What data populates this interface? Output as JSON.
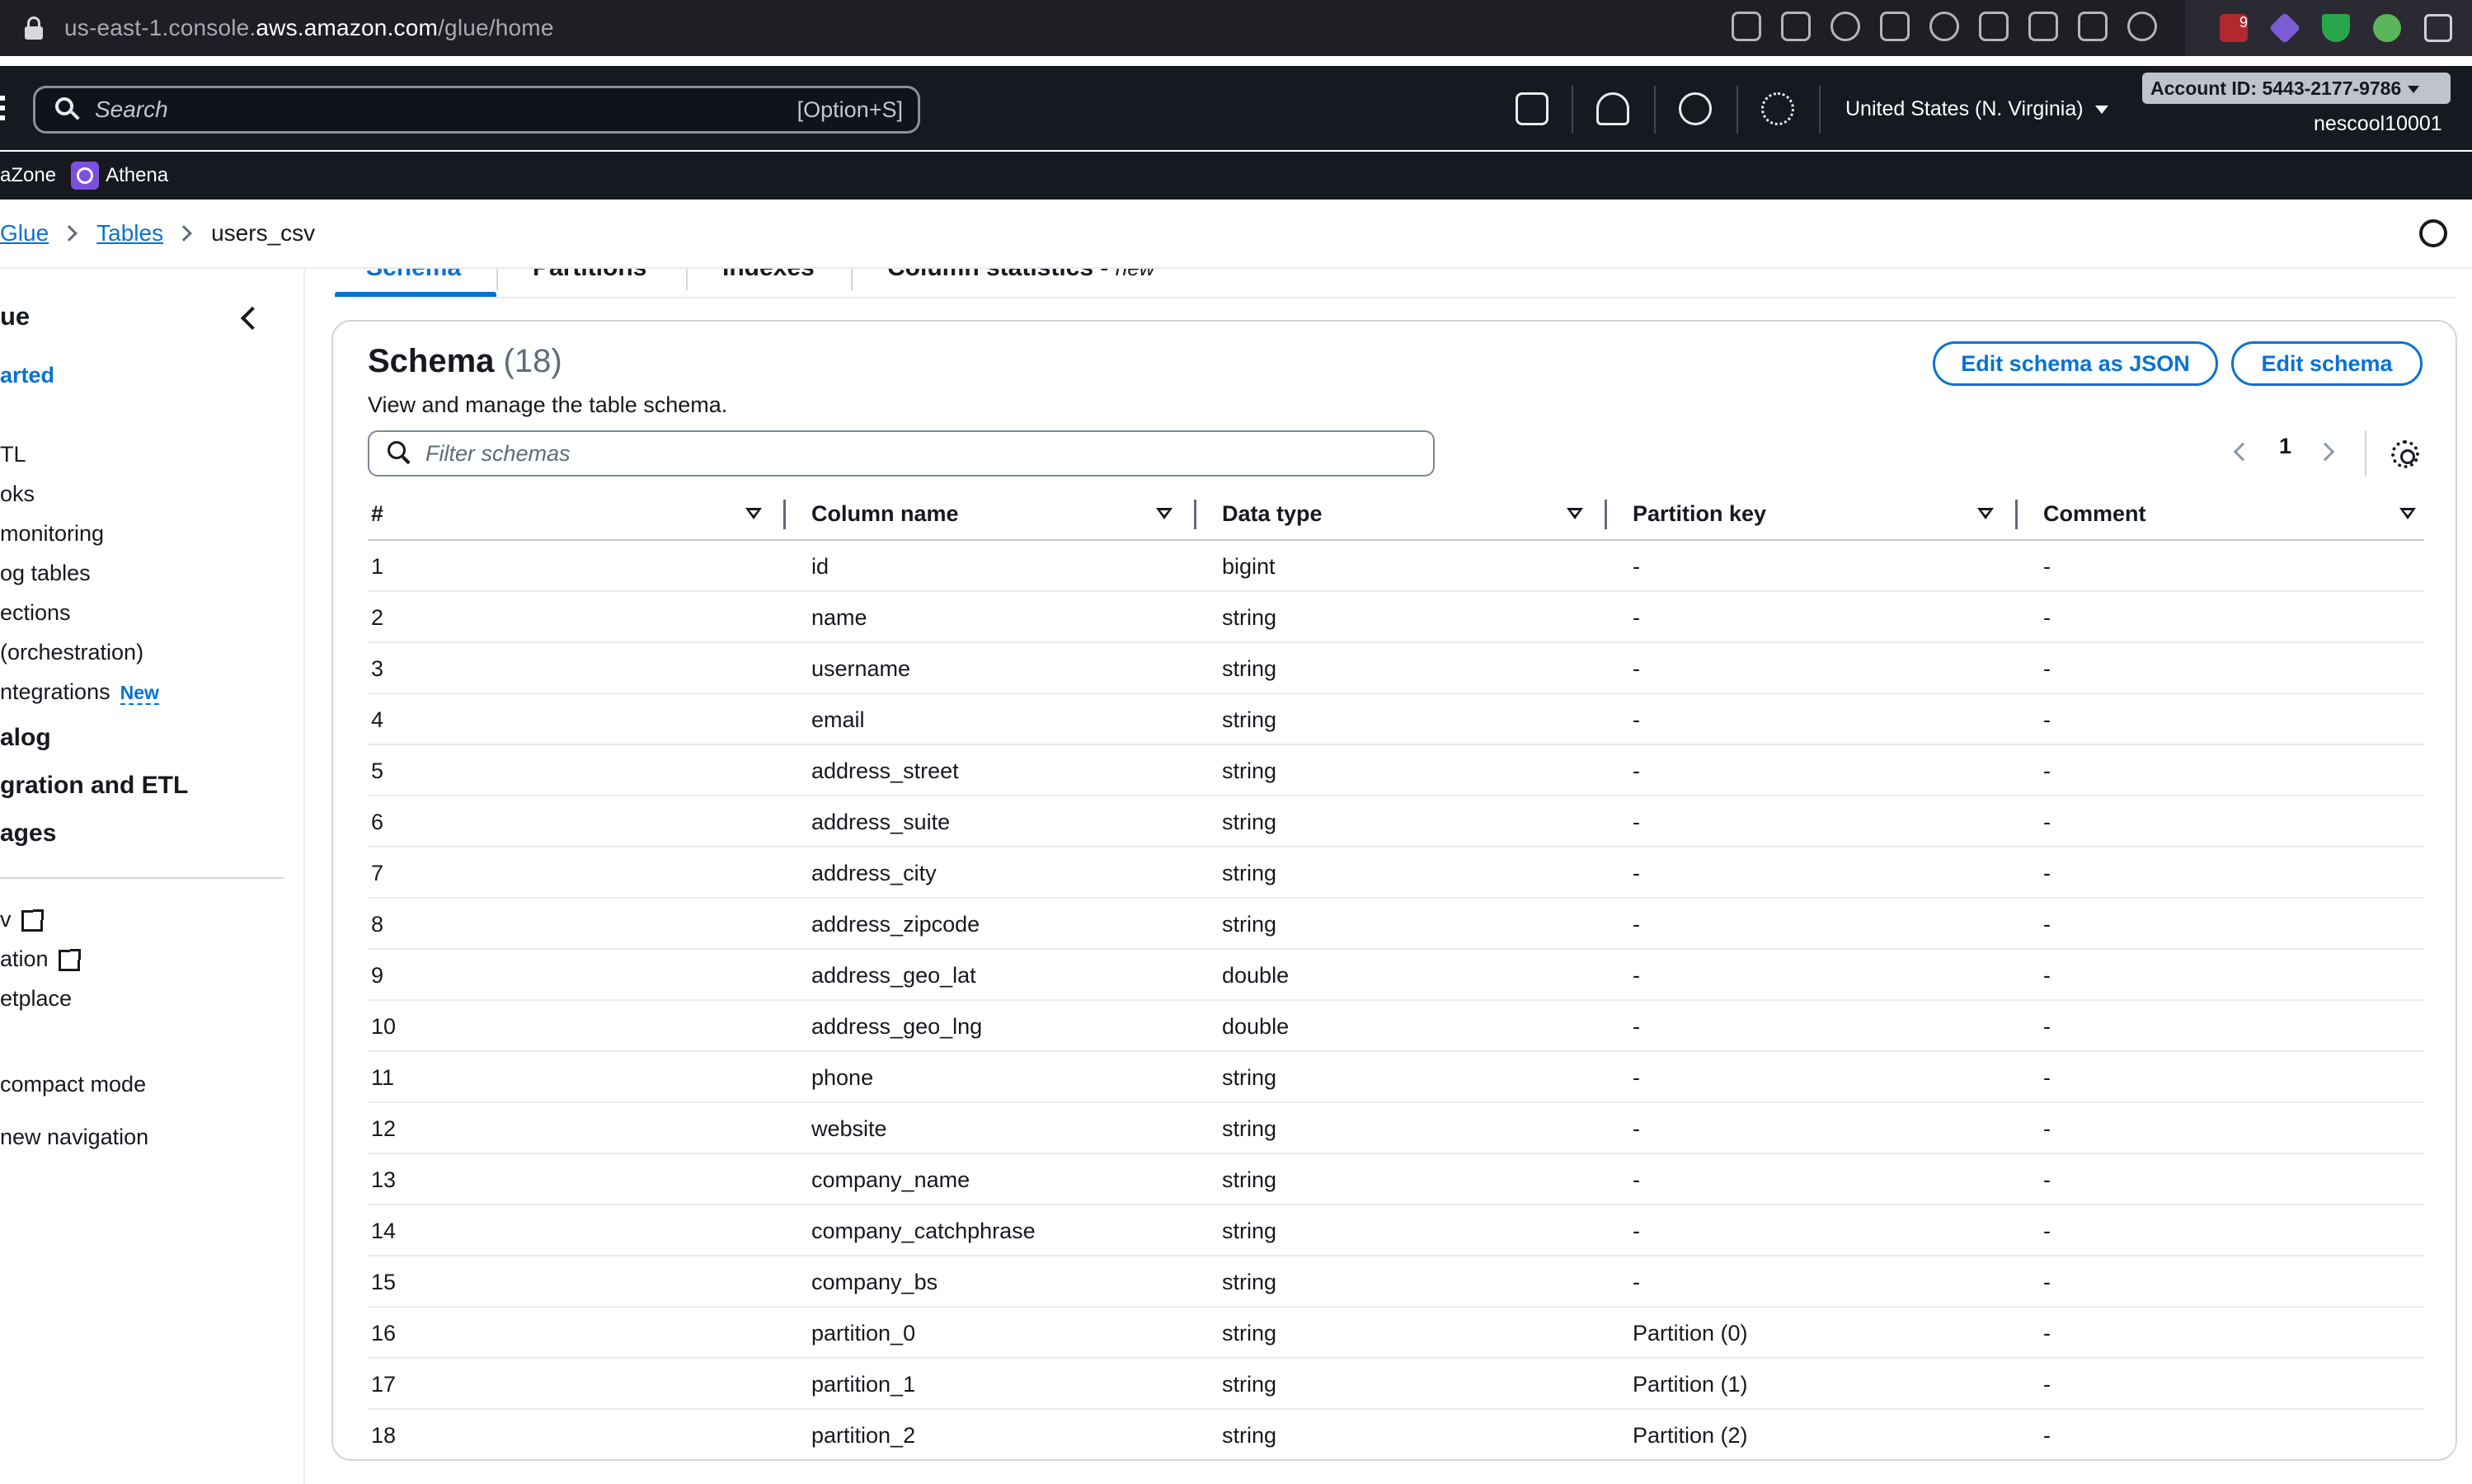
{
  "browser": {
    "url_prefix": "us-east-1.console.",
    "url_host": "aws.amazon.com",
    "url_path": "/glue/home",
    "extension_badge": "9"
  },
  "aws_nav": {
    "search_placeholder": "Search",
    "search_shortcut": "[Option+S]",
    "region": "United States (N. Virginia)",
    "account": "Account ID: 5443-2177-9786",
    "username": "nescool10001"
  },
  "shortcuts": [
    {
      "label": "aZone"
    },
    {
      "label": "Athena"
    }
  ],
  "breadcrumb": {
    "items": [
      "Glue",
      "Tables"
    ],
    "current": "users_csv"
  },
  "sidebar": {
    "title": "ue",
    "getting_started": "arted",
    "items": [
      "TL",
      "oks",
      " monitoring",
      "og tables",
      "ections",
      " (orchestration)",
      "ntegrations"
    ],
    "new_badge": "New",
    "sections": [
      "alog",
      "gration and ETL",
      "ages"
    ],
    "links": [
      "v",
      "ation",
      "etplace"
    ],
    "settings": [
      "compact mode",
      "new navigation"
    ]
  },
  "tabs": {
    "items": [
      "Schema",
      "Partitions",
      "Indexes",
      "Column statistics"
    ],
    "new_label": "new"
  },
  "schema": {
    "title": "Schema",
    "count": "(18)",
    "description": "View and manage the table schema.",
    "edit_json_button": "Edit schema as JSON",
    "edit_button": "Edit schema",
    "filter_placeholder": "Filter schemas",
    "page": "1",
    "columns": [
      "#",
      "Column name",
      "Data type",
      "Partition key",
      "Comment"
    ],
    "rows": [
      {
        "num": "1",
        "name": "id",
        "type": "bigint",
        "partition": "-",
        "comment": "-"
      },
      {
        "num": "2",
        "name": "name",
        "type": "string",
        "partition": "-",
        "comment": "-"
      },
      {
        "num": "3",
        "name": "username",
        "type": "string",
        "partition": "-",
        "comment": "-"
      },
      {
        "num": "4",
        "name": "email",
        "type": "string",
        "partition": "-",
        "comment": "-"
      },
      {
        "num": "5",
        "name": "address_street",
        "type": "string",
        "partition": "-",
        "comment": "-"
      },
      {
        "num": "6",
        "name": "address_suite",
        "type": "string",
        "partition": "-",
        "comment": "-"
      },
      {
        "num": "7",
        "name": "address_city",
        "type": "string",
        "partition": "-",
        "comment": "-"
      },
      {
        "num": "8",
        "name": "address_zipcode",
        "type": "string",
        "partition": "-",
        "comment": "-"
      },
      {
        "num": "9",
        "name": "address_geo_lat",
        "type": "double",
        "partition": "-",
        "comment": "-"
      },
      {
        "num": "10",
        "name": "address_geo_lng",
        "type": "double",
        "partition": "-",
        "comment": "-"
      },
      {
        "num": "11",
        "name": "phone",
        "type": "string",
        "partition": "-",
        "comment": "-"
      },
      {
        "num": "12",
        "name": "website",
        "type": "string",
        "partition": "-",
        "comment": "-"
      },
      {
        "num": "13",
        "name": "company_name",
        "type": "string",
        "partition": "-",
        "comment": "-"
      },
      {
        "num": "14",
        "name": "company_catchphrase",
        "type": "string",
        "partition": "-",
        "comment": "-"
      },
      {
        "num": "15",
        "name": "company_bs",
        "type": "string",
        "partition": "-",
        "comment": "-"
      },
      {
        "num": "16",
        "name": "partition_0",
        "type": "string",
        "partition": "Partition (0)",
        "comment": "-"
      },
      {
        "num": "17",
        "name": "partition_1",
        "type": "string",
        "partition": "Partition (1)",
        "comment": "-"
      },
      {
        "num": "18",
        "name": "partition_2",
        "type": "string",
        "partition": "Partition (2)",
        "comment": "-"
      }
    ]
  },
  "colors": {
    "link": "#0972d3",
    "nav_bg": "#16191f",
    "border": "#d1d5db"
  }
}
